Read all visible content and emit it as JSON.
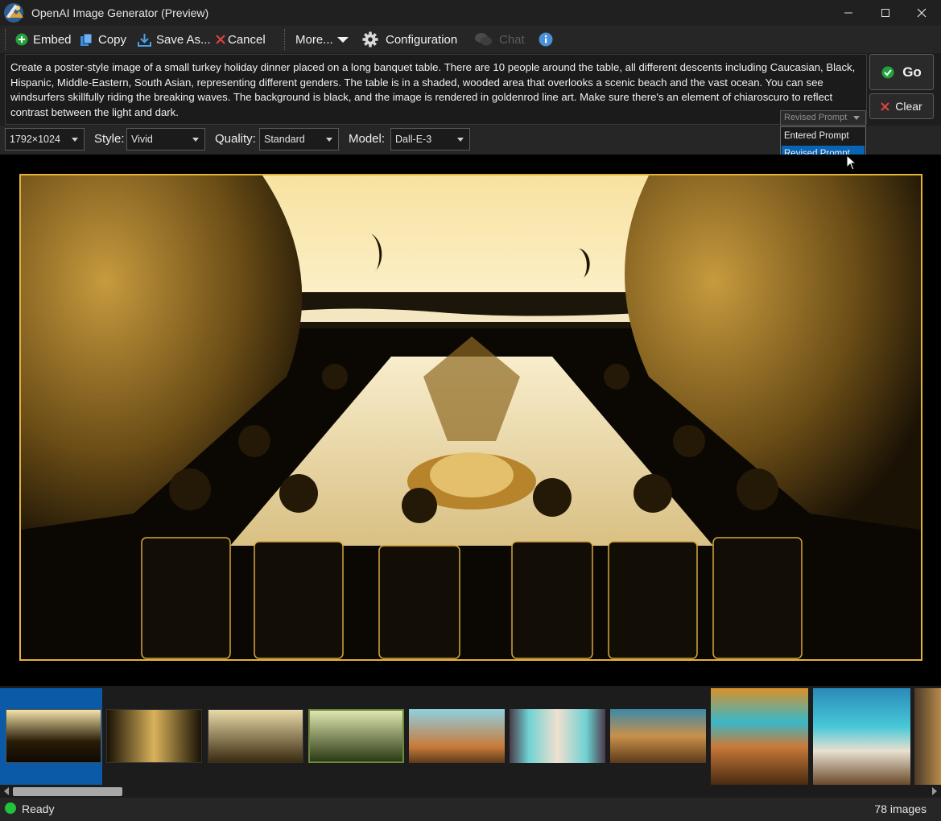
{
  "window": {
    "title": "OpenAI Image Generator (Preview)"
  },
  "toolbar": {
    "embed": "Embed",
    "copy": "Copy",
    "save_as": "Save As...",
    "cancel": "Cancel",
    "more": "More...",
    "configuration": "Configuration",
    "chat": "Chat"
  },
  "prompt": {
    "text": "Create a poster-style image of a small turkey holiday dinner placed on a long banquet table. There are 10 people around the table, all different descents including Caucasian, Black, Hispanic, Middle-Eastern, South Asian, representing different genders. The table is in a shaded, wooded area that overlooks a scenic beach and the vast ocean. You can see windsurfers skillfully riding the breaking waves. The background is black, and the image is rendered in goldenrod line art. Make sure there's an element of chiaroscuro to reflect contrast between the light and dark.",
    "mode_selected": "Revised Prompt",
    "mode_options": [
      "Entered Prompt",
      "Revised Prompt"
    ]
  },
  "actions": {
    "go": "Go",
    "clear": "Clear"
  },
  "options": {
    "size": "1792×1024",
    "style_label": "Style:",
    "style": "Vivid",
    "quality_label": "Quality:",
    "quality": "Standard",
    "model_label": "Model:",
    "model": "Dall-E-3"
  },
  "colors": {
    "accent_blue": "#0a64b4",
    "gold_border": "#e2b23a",
    "status_green": "#22c33a"
  },
  "status": {
    "text": "Ready",
    "image_count": "78 images"
  }
}
